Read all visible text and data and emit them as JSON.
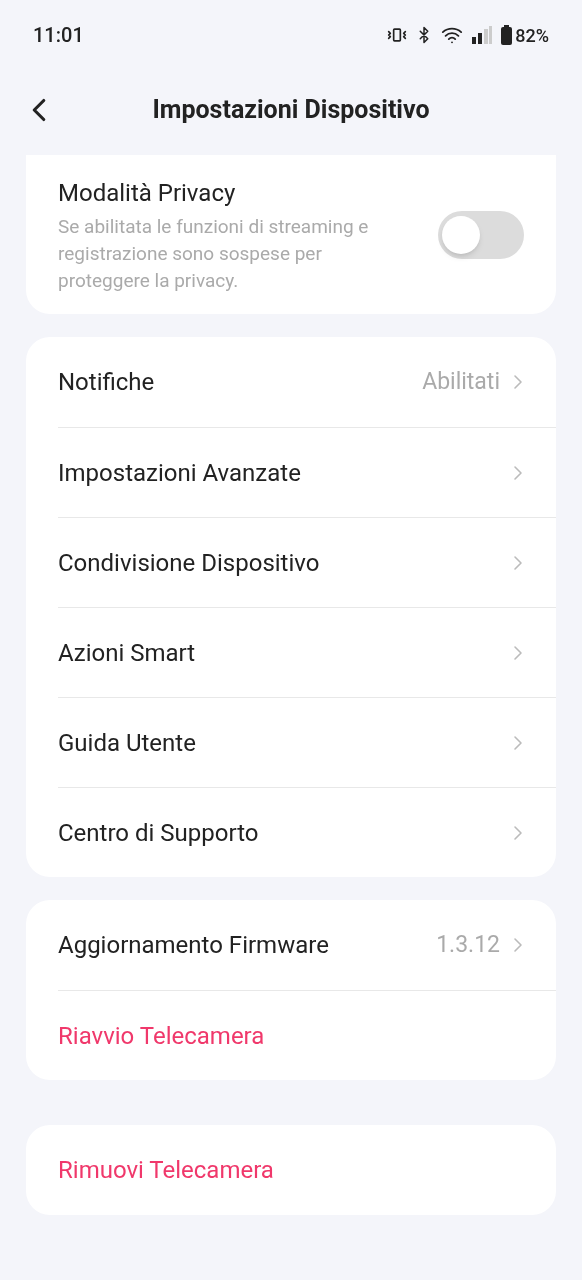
{
  "status_bar": {
    "time": "11:01",
    "battery": "82%"
  },
  "header": {
    "title": "Impostazioni Dispositivo"
  },
  "privacy": {
    "title": "Modalità Privacy",
    "description": "Se abilitata le funzioni di streaming e registrazione sono sospese per proteggere la privacy.",
    "on": false
  },
  "groups": [
    {
      "items": [
        {
          "label": "Notifiche",
          "value": "Abilitati",
          "kind": "link"
        },
        {
          "label": "Impostazioni Avanzate",
          "kind": "link"
        },
        {
          "label": "Condivisione Dispositivo",
          "kind": "link"
        },
        {
          "label": "Azioni Smart",
          "kind": "link"
        },
        {
          "label": "Guida Utente",
          "kind": "link"
        },
        {
          "label": "Centro di Supporto",
          "kind": "link"
        }
      ]
    },
    {
      "items": [
        {
          "label": "Aggiornamento Firmware",
          "value": "1.3.12",
          "kind": "link"
        },
        {
          "label": "Riavvio Telecamera",
          "kind": "danger"
        }
      ]
    },
    {
      "items": [
        {
          "label": "Rimuovi Telecamera",
          "kind": "danger"
        }
      ]
    }
  ]
}
